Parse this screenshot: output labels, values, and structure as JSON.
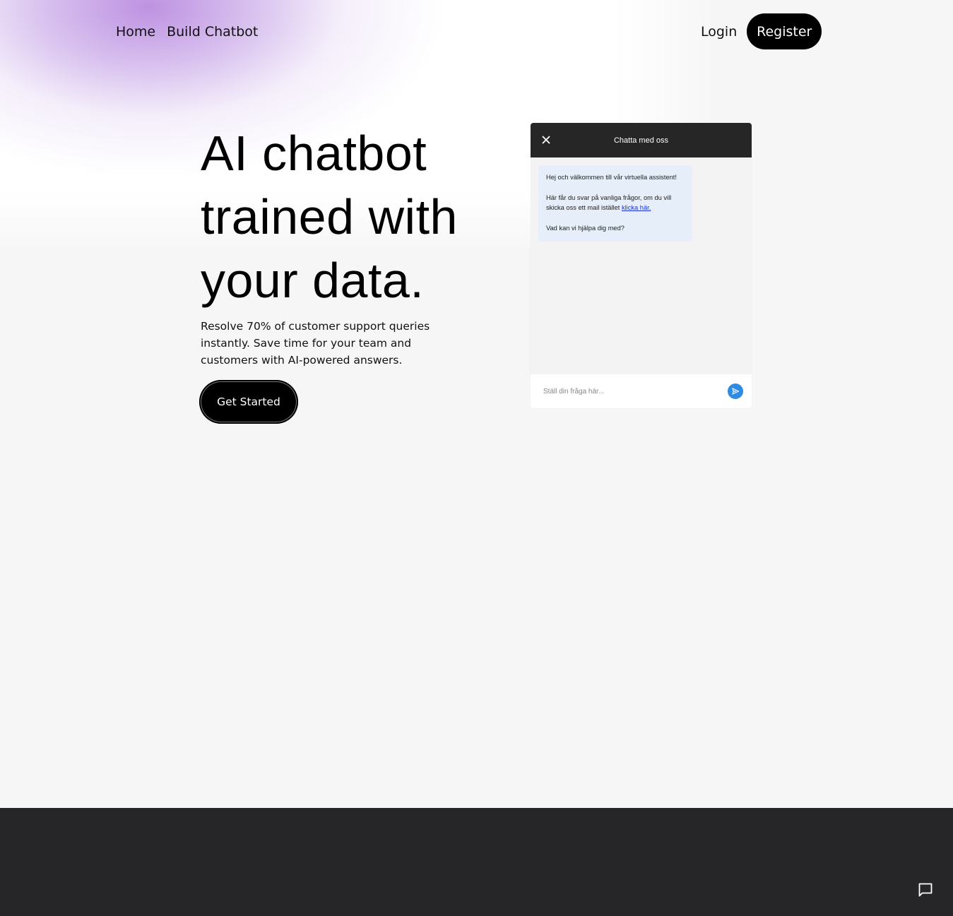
{
  "nav": {
    "home": "Home",
    "build_chatbot": "Build Chatbot",
    "login": "Login",
    "register": "Register"
  },
  "hero": {
    "title": "AI chatbot trained with your data.",
    "subtitle": "Resolve 70% of customer support queries instantly. Save time for your team and customers with AI-powered answers.",
    "cta": "Get Started"
  },
  "chat": {
    "title": "Chatta med oss",
    "close_icon": "close-icon",
    "messages": {
      "greeting": "Hej och välkommen till vår virtuella assistent!",
      "info_prefix": "Här får du svar på vanliga frågor, om du vill skicka oss ett mail istället ",
      "info_link": "klicka här.",
      "question": "Vad kan vi hjälpa dig med?"
    },
    "input_placeholder": "Ställ din fråga här...",
    "send_icon": "send-icon",
    "send_color": "#2f8ae2"
  },
  "fab": {
    "icon": "chat-bubble-icon"
  },
  "colors": {
    "accent_purple": "#ba8ce0",
    "dark": "#262628",
    "background": "#f6f6f6"
  }
}
